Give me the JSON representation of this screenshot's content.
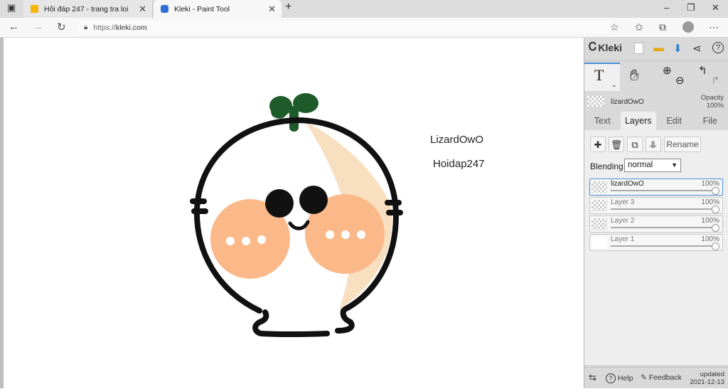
{
  "browser": {
    "tabs": [
      {
        "title": "Hỏi đáp 247 - trang tra loi",
        "active": false
      },
      {
        "title": "Kleki - Paint Tool",
        "active": true
      }
    ],
    "url_protocol": "https://",
    "url_host": "kleki.com"
  },
  "canvas": {
    "texts": [
      "LizardOwO",
      "Hoidap247"
    ]
  },
  "sidebar": {
    "logo": "Kleki",
    "tool_text_glyph": "T",
    "current_layer_name": "lizardOwO",
    "opacity_label": "Opacity",
    "opacity_value": "100%",
    "tabs": [
      "Text",
      "Layers",
      "Edit",
      "File"
    ],
    "active_tab": "Layers",
    "rename_label": "Rename",
    "blending_label": "Blending",
    "blending_value": "normal",
    "layers": [
      {
        "name": "lizardOwO",
        "opacity": "100%",
        "selected": true
      },
      {
        "name": "Layer 3",
        "opacity": "100%",
        "selected": false
      },
      {
        "name": "Layer 2",
        "opacity": "100%",
        "selected": false
      },
      {
        "name": "Layer 1",
        "opacity": "100%",
        "selected": false
      }
    ],
    "footer": {
      "help": "Help",
      "feedback": "Feedback",
      "updated_label": "updated",
      "updated_date": "2021-12-13"
    }
  },
  "colors": {
    "stroke": "#111111",
    "leaf": "#1f5a2a",
    "cheek": "#fbb98a",
    "shade": "#f8dfc0",
    "accent": "#4a90d9"
  }
}
